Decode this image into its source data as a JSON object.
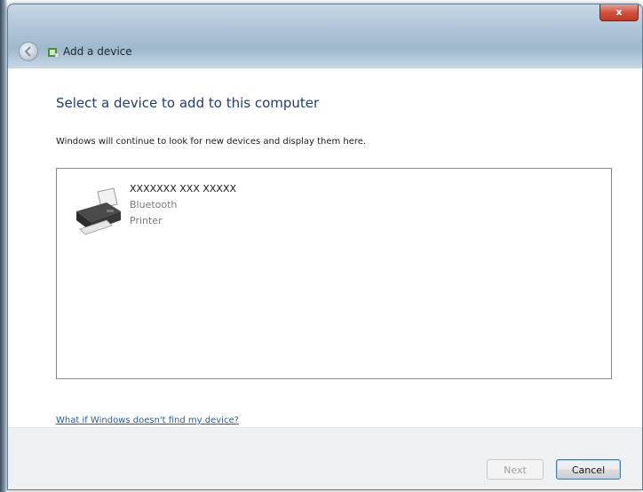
{
  "window": {
    "title": "Add a device",
    "close_label": "x"
  },
  "main": {
    "heading": "Select a device to add to this computer",
    "description": "Windows will continue to look for new devices and display them here.",
    "devices": [
      {
        "name": "XXXXXXX XXX XXXXX",
        "type": "Bluetooth",
        "category": "Printer",
        "icon": "printer-icon"
      }
    ],
    "help_link": "What if Windows doesn't find my device?"
  },
  "footer": {
    "next_label": "Next",
    "cancel_label": "Cancel"
  },
  "colors": {
    "heading": "#1f3d78",
    "link": "#1e5aa8",
    "close_button": "#d2513e"
  }
}
